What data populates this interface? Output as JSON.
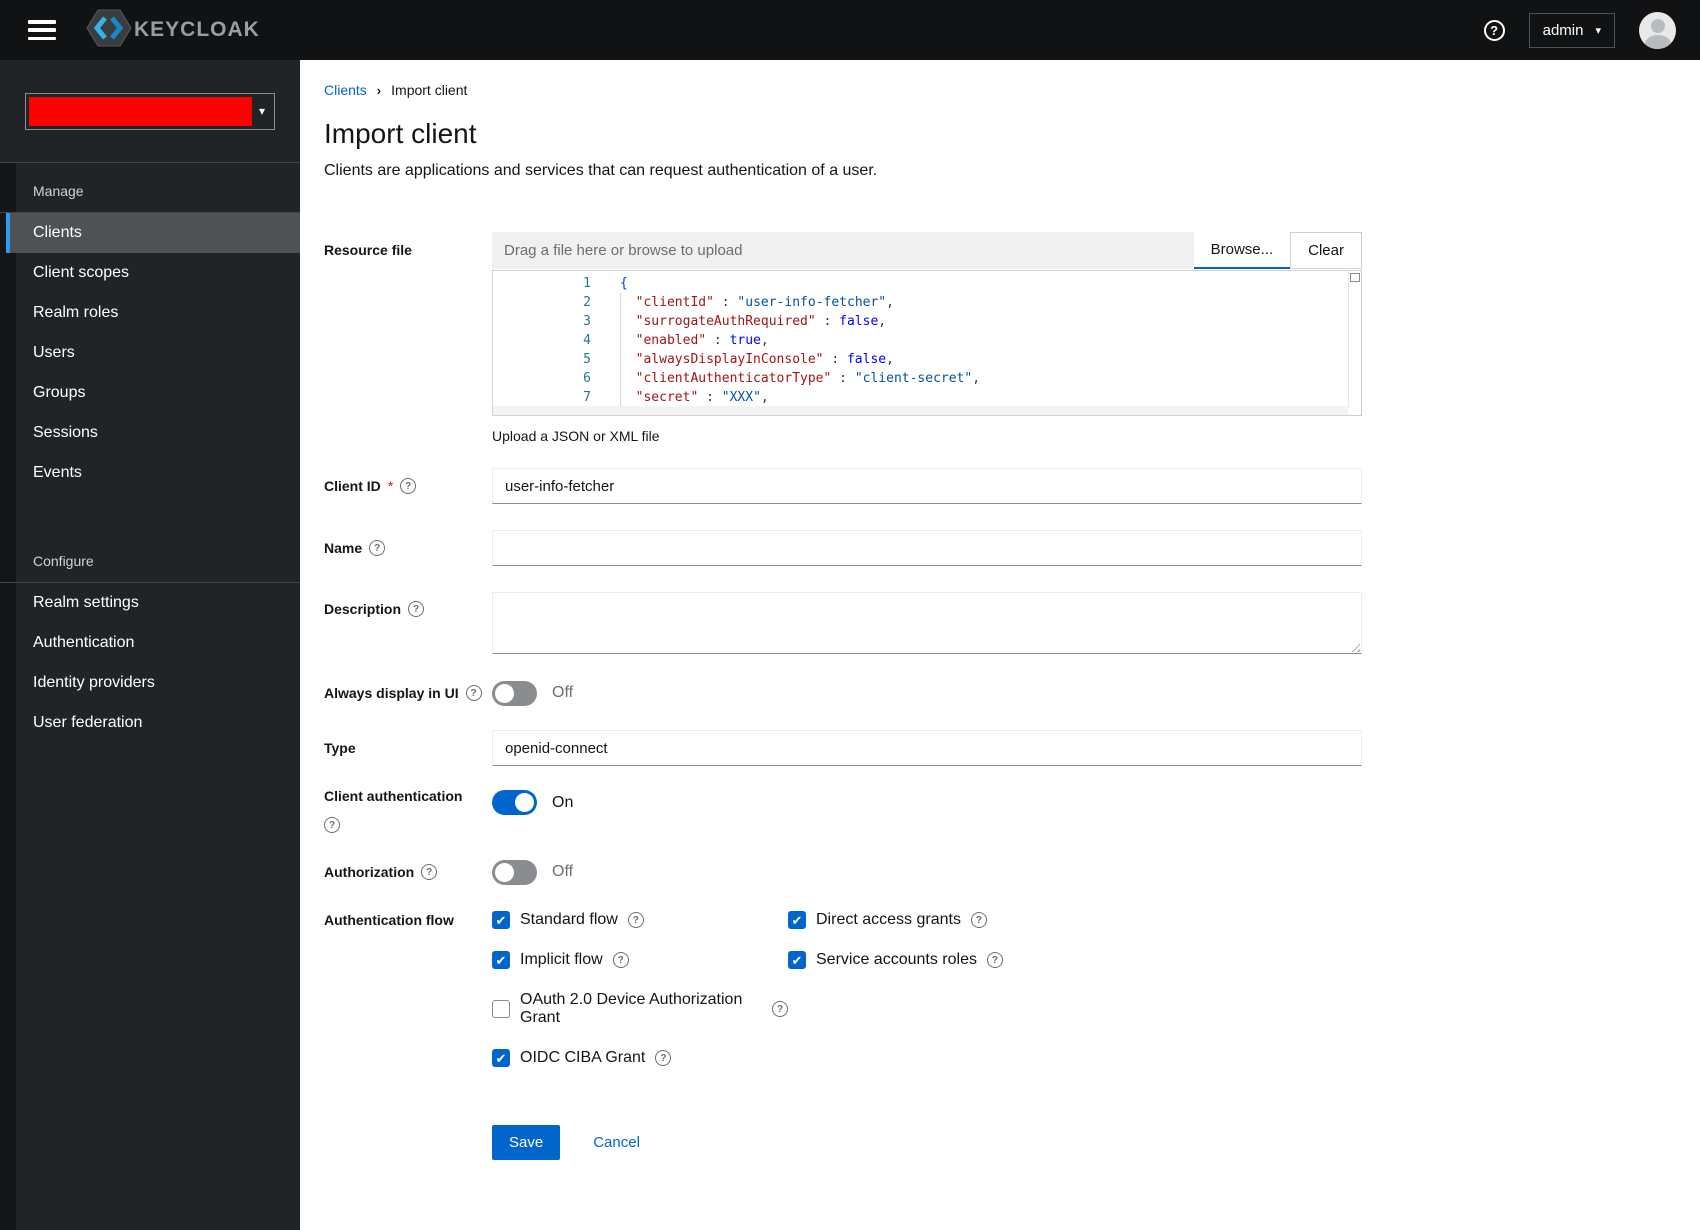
{
  "topbar": {
    "brand": "KEYCLOAK",
    "help_icon": "?",
    "user_menu": {
      "label": "admin",
      "caret": "▾"
    }
  },
  "sidebar": {
    "realm_selector": {
      "caret": "▾"
    },
    "groups": [
      {
        "label": "Manage",
        "items": [
          {
            "label": "Clients",
            "active": true
          },
          {
            "label": "Client scopes"
          },
          {
            "label": "Realm roles"
          },
          {
            "label": "Users"
          },
          {
            "label": "Groups"
          },
          {
            "label": "Sessions"
          },
          {
            "label": "Events"
          }
        ]
      },
      {
        "label": "Configure",
        "items": [
          {
            "label": "Realm settings"
          },
          {
            "label": "Authentication"
          },
          {
            "label": "Identity providers"
          },
          {
            "label": "User federation"
          }
        ]
      }
    ]
  },
  "breadcrumb": {
    "items": [
      {
        "label": "Clients"
      },
      {
        "label": "Import client"
      }
    ],
    "separator": "›"
  },
  "page": {
    "title": "Import client",
    "subtitle": "Clients are applications and services that can request authentication of a user."
  },
  "form": {
    "resource_file": {
      "label": "Resource file",
      "dropzone_placeholder": "Drag a file here or browse to upload",
      "browse_label": "Browse...",
      "clear_label": "Clear",
      "helper": "Upload a JSON or XML file",
      "code": {
        "lines": [
          {
            "num": "1",
            "tokens": [
              {
                "c": "bracket",
                "t": "{"
              }
            ]
          },
          {
            "num": "2",
            "tokens": [
              {
                "c": "plain",
                "t": "  "
              },
              {
                "c": "key",
                "t": "\"clientId\""
              },
              {
                "c": "plain",
                "t": " : "
              },
              {
                "c": "str",
                "t": "\"user-info-fetcher\""
              },
              {
                "c": "plain",
                "t": ","
              }
            ]
          },
          {
            "num": "3",
            "tokens": [
              {
                "c": "plain",
                "t": "  "
              },
              {
                "c": "key",
                "t": "\"surrogateAuthRequired\""
              },
              {
                "c": "plain",
                "t": " : "
              },
              {
                "c": "bool",
                "t": "false"
              },
              {
                "c": "plain",
                "t": ","
              }
            ]
          },
          {
            "num": "4",
            "tokens": [
              {
                "c": "plain",
                "t": "  "
              },
              {
                "c": "key",
                "t": "\"enabled\""
              },
              {
                "c": "plain",
                "t": " : "
              },
              {
                "c": "bool",
                "t": "true"
              },
              {
                "c": "plain",
                "t": ","
              }
            ]
          },
          {
            "num": "5",
            "tokens": [
              {
                "c": "plain",
                "t": "  "
              },
              {
                "c": "key",
                "t": "\"alwaysDisplayInConsole\""
              },
              {
                "c": "plain",
                "t": " : "
              },
              {
                "c": "bool",
                "t": "false"
              },
              {
                "c": "plain",
                "t": ","
              }
            ]
          },
          {
            "num": "6",
            "tokens": [
              {
                "c": "plain",
                "t": "  "
              },
              {
                "c": "key",
                "t": "\"clientAuthenticatorType\""
              },
              {
                "c": "plain",
                "t": " : "
              },
              {
                "c": "str",
                "t": "\"client-secret\""
              },
              {
                "c": "plain",
                "t": ","
              }
            ]
          },
          {
            "num": "7",
            "tokens": [
              {
                "c": "plain",
                "t": "  "
              },
              {
                "c": "key",
                "t": "\"secret\""
              },
              {
                "c": "plain",
                "t": " : "
              },
              {
                "c": "str",
                "t": "\"XXX\""
              },
              {
                "c": "plain",
                "t": ","
              }
            ]
          }
        ]
      }
    },
    "client_id": {
      "label": "Client ID",
      "required": "*",
      "value": "user-info-fetcher"
    },
    "name": {
      "label": "Name",
      "value": ""
    },
    "description": {
      "label": "Description",
      "value": ""
    },
    "always_display": {
      "label": "Always display in UI",
      "state_label": "Off",
      "on": false
    },
    "type": {
      "label": "Type",
      "value": "openid-connect"
    },
    "client_auth": {
      "label": "Client authentication",
      "state_label": "On",
      "on": true
    },
    "authorization": {
      "label": "Authorization",
      "state_label": "Off",
      "on": false
    },
    "auth_flow": {
      "label": "Authentication flow",
      "options": [
        {
          "label": "Standard flow",
          "checked": true,
          "col": 1
        },
        {
          "label": "Direct access grants",
          "checked": true,
          "col": 2
        },
        {
          "label": "Implicit flow",
          "checked": true,
          "col": 1
        },
        {
          "label": "Service accounts roles",
          "checked": true,
          "col": 2
        },
        {
          "label": "OAuth 2.0 Device Authorization Grant",
          "checked": false,
          "col": 1
        },
        {
          "label": "OIDC CIBA Grant",
          "checked": true,
          "col": 1
        }
      ]
    }
  },
  "actions": {
    "save": "Save",
    "cancel": "Cancel"
  },
  "colors": {
    "primary": "#0066cc",
    "topbar_bg": "#111214",
    "sidebar_bg": "#212427",
    "nav_active_bg": "#4f5255",
    "nav_active_bar": "#2b9af3",
    "realm_redaction": "#ff0000",
    "code_key": "#a31515",
    "code_string": "#0451a5",
    "code_bool": "#0000ff",
    "code_line_number": "#237893",
    "required_asterisk": "#c9190b"
  }
}
